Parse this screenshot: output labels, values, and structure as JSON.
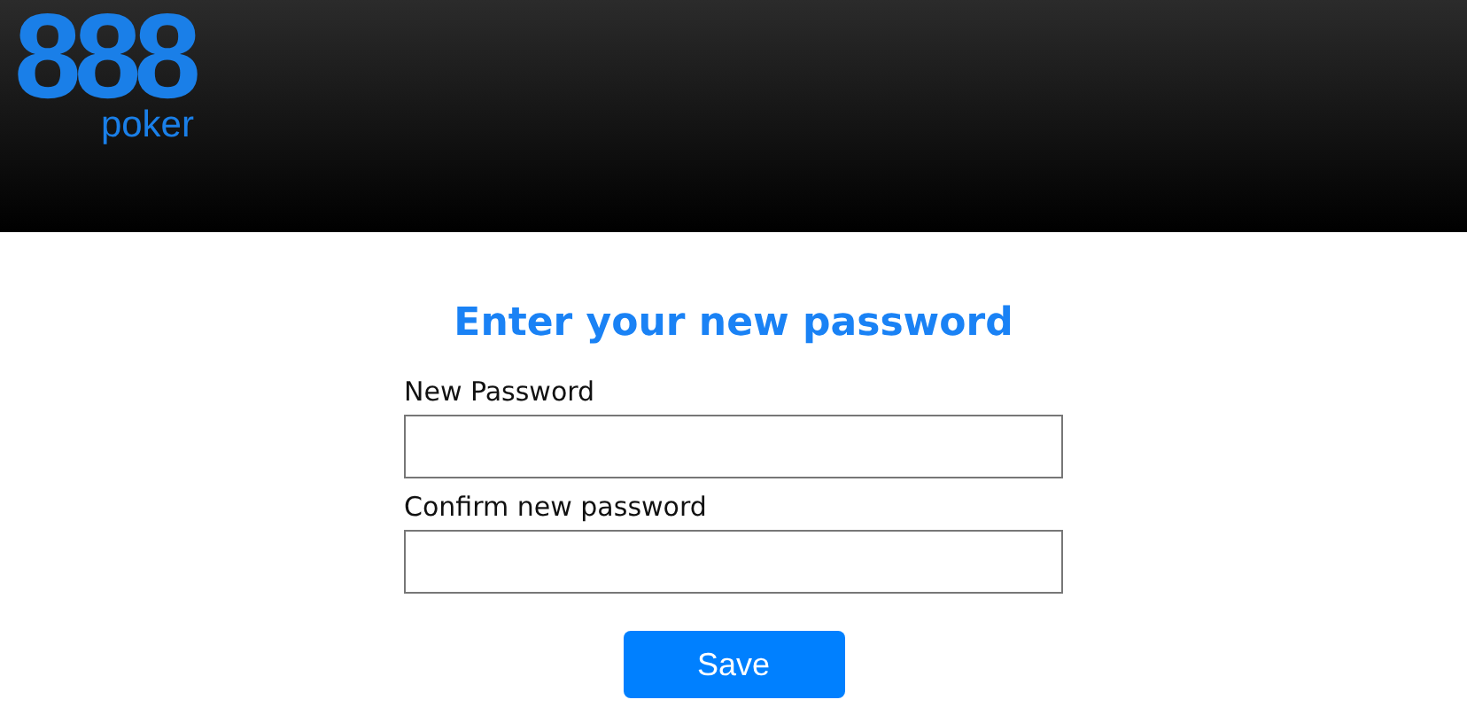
{
  "header": {
    "logo": {
      "mark": "888",
      "wordmark": "poker"
    }
  },
  "form": {
    "title": "Enter your new password",
    "fields": [
      {
        "label": "New Password"
      },
      {
        "label": "Confirm new password"
      }
    ],
    "button": "Save"
  }
}
